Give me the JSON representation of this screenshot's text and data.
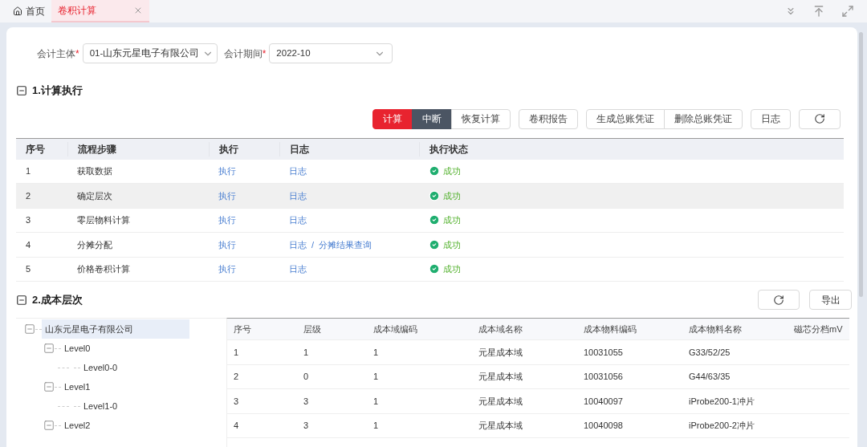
{
  "tabs": [
    {
      "label": "首页",
      "kind": "home",
      "selected": false
    },
    {
      "label": "卷积计算",
      "kind": "page",
      "selected": true,
      "closable": true
    }
  ],
  "filters": [
    {
      "label": "会计主体",
      "required_mark": "*",
      "value": "01-山东元星电子有限公司"
    },
    {
      "label": "会计期间",
      "required_mark": "*",
      "value": "2022-10"
    }
  ],
  "section1": {
    "title": "1.计算执行",
    "expanded": true,
    "button_groups": [
      [
        {
          "label": "计算",
          "kind": "danger"
        },
        {
          "label": "中断",
          "kind": "dark"
        },
        {
          "label": "恢复计算",
          "kind": "plain"
        }
      ],
      [
        {
          "label": "卷积报告",
          "kind": "plain"
        }
      ],
      [
        {
          "label": "生成总账凭证",
          "kind": "plain"
        },
        {
          "label": "删除总账凭证",
          "kind": "plain"
        }
      ],
      [
        {
          "label": "日志",
          "kind": "plain"
        }
      ],
      [
        {
          "kind": "refresh"
        }
      ]
    ],
    "columns": [
      "序号",
      "流程步骤",
      "执行",
      "日志",
      "执行状态"
    ],
    "rows": [
      {
        "no": "1",
        "step": "获取数据",
        "run": "执行",
        "logs": [
          "日志"
        ],
        "status": "成功",
        "selected": false
      },
      {
        "no": "2",
        "step": "确定层次",
        "run": "执行",
        "logs": [
          "日志"
        ],
        "status": "成功",
        "selected": true
      },
      {
        "no": "3",
        "step": "零层物料计算",
        "run": "执行",
        "logs": [
          "日志"
        ],
        "status": "成功",
        "selected": false
      },
      {
        "no": "4",
        "step": "分摊分配",
        "run": "执行",
        "logs": [
          "日志",
          "分摊结果查询"
        ],
        "status": "成功",
        "selected": false
      },
      {
        "no": "5",
        "step": "价格卷积计算",
        "run": "执行",
        "logs": [
          "日志"
        ],
        "status": "成功",
        "selected": false
      }
    ],
    "log_separator": "/"
  },
  "section2": {
    "title": "2.成本层次",
    "expanded": true,
    "export": "导出",
    "tree": [
      {
        "label": "山东元星电子有限公司",
        "expanded": true,
        "selected": true,
        "children": [
          {
            "label": "Level0",
            "expanded": true,
            "selected": false,
            "children": [
              {
                "label": "Level0-0",
                "selected": false
              }
            ]
          },
          {
            "label": "Level1",
            "expanded": true,
            "selected": false,
            "children": [
              {
                "label": "Level1-0",
                "selected": false
              }
            ]
          },
          {
            "label": "Level2",
            "expanded": true,
            "selected": false
          }
        ]
      }
    ],
    "columns": [
      "序号",
      "层级",
      "成本域编码",
      "成本域名称",
      "成本物料编码",
      "成本物料名称",
      "磁芯分档mV"
    ],
    "rows": [
      [
        "1",
        "1",
        "1",
        "元星成本域",
        "10031055",
        "G33/52/25"
      ],
      [
        "2",
        "0",
        "1",
        "元星成本域",
        "10031056",
        "G44/63/35"
      ],
      [
        "3",
        "3",
        "1",
        "元星成本域",
        "10040097",
        "iProbe200-1冲片"
      ],
      [
        "4",
        "3",
        "1",
        "元星成本域",
        "10040098",
        "iProbe200-2冲片"
      ]
    ]
  }
}
